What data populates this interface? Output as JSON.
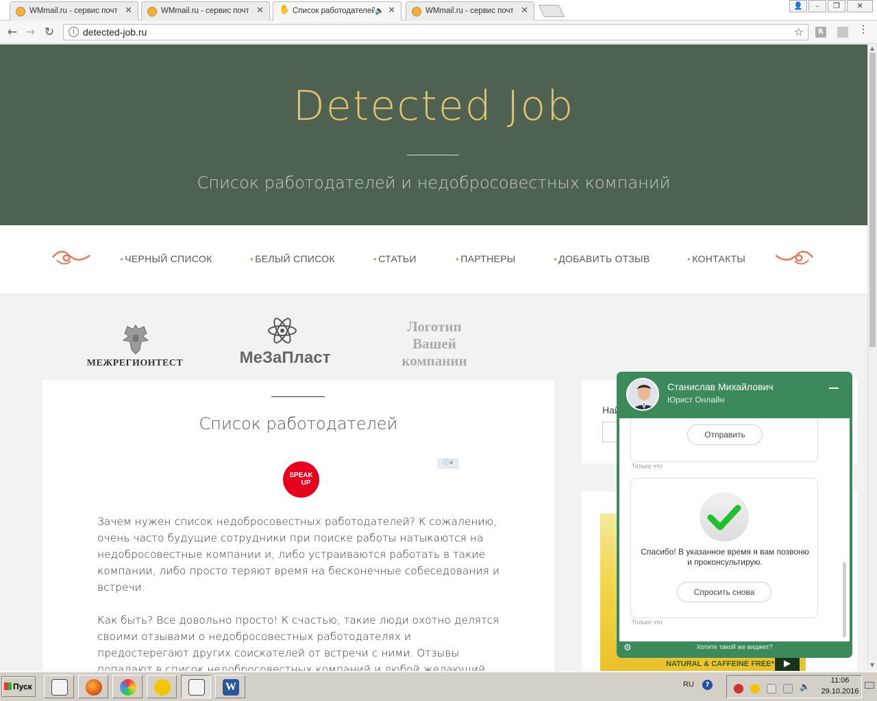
{
  "browser": {
    "tabs": [
      {
        "title": "WMmail.ru - сервис почтово",
        "active": false
      },
      {
        "title": "WMmail.ru - сервис почтово",
        "active": false
      },
      {
        "title": "Список работодателей",
        "active": true
      },
      {
        "title": "WMmail.ru - сервис почтово",
        "active": false
      }
    ],
    "close_glyph": "✕",
    "url": "detected-job.ru",
    "ext_label": "R"
  },
  "hero": {
    "title": "Detected Job",
    "subtitle": "Список работодателей и недобросовестных компаний"
  },
  "nav": {
    "items": [
      "ЧЕРНЫЙ СПИСОК",
      "БЕЛЫЙ СПИСОК",
      "СТАТЬИ",
      "ПАРТНЕРЫ",
      "ДОБАВИТЬ ОТЗЫВ",
      "КОНТАКТЫ"
    ]
  },
  "partners": {
    "logo1": "МЕЖРЕГИОНТЕСТ",
    "logo2": "МеЗаПласт",
    "logo3": [
      "Логотип",
      "Вашей",
      "компании"
    ]
  },
  "content": {
    "title": "Список работодателей",
    "ad_line1": "SPEAK",
    "ad_line2": "UP",
    "ad_badge": "ⓘ✕",
    "para1": "Зачем нужен список недобросовестных работодателей? К сожалению, очень часто будущие сотрудники при поиске работы натыкаются на недобросовестные компании и, либо устраиваются работать в такие компании, либо просто теряют время на бесконечные собеседования и встречи.",
    "para2": "Как быть? Все довольно просто! К счастью, такие люди охотно делятся своими отзывами о недобросовестных работодателях и предостерегают других соискателей от встречи с ними. Отзывы попадают в список недобросовестных компаний и любой желающий может ознакомиться с"
  },
  "sidebar": {
    "search_label": "Най",
    "banner_slogan": "NATURAL & CAFFEINE FREE*"
  },
  "chat": {
    "name": "Станислав Михайлович",
    "role": "Юрист Онлайн",
    "send_button": "Отправить",
    "timestamp": "Только что",
    "thanks": "Спасибо! В указанное время я вам позвоню и проконсультирую.",
    "ask_again": "Спросить снова",
    "footer": "Хотите такой же виджет?"
  },
  "taskbar": {
    "start": "Пуск",
    "lang": "RU",
    "help": "?",
    "time": "11:06",
    "date": "29.10.2016"
  },
  "colors": {
    "hero_bg": "#4f6151",
    "title_gold": "#e6c46e",
    "ornament": "#e07a5f",
    "chat_green": "#3c8a5c",
    "check_green": "#1fbf2f"
  }
}
